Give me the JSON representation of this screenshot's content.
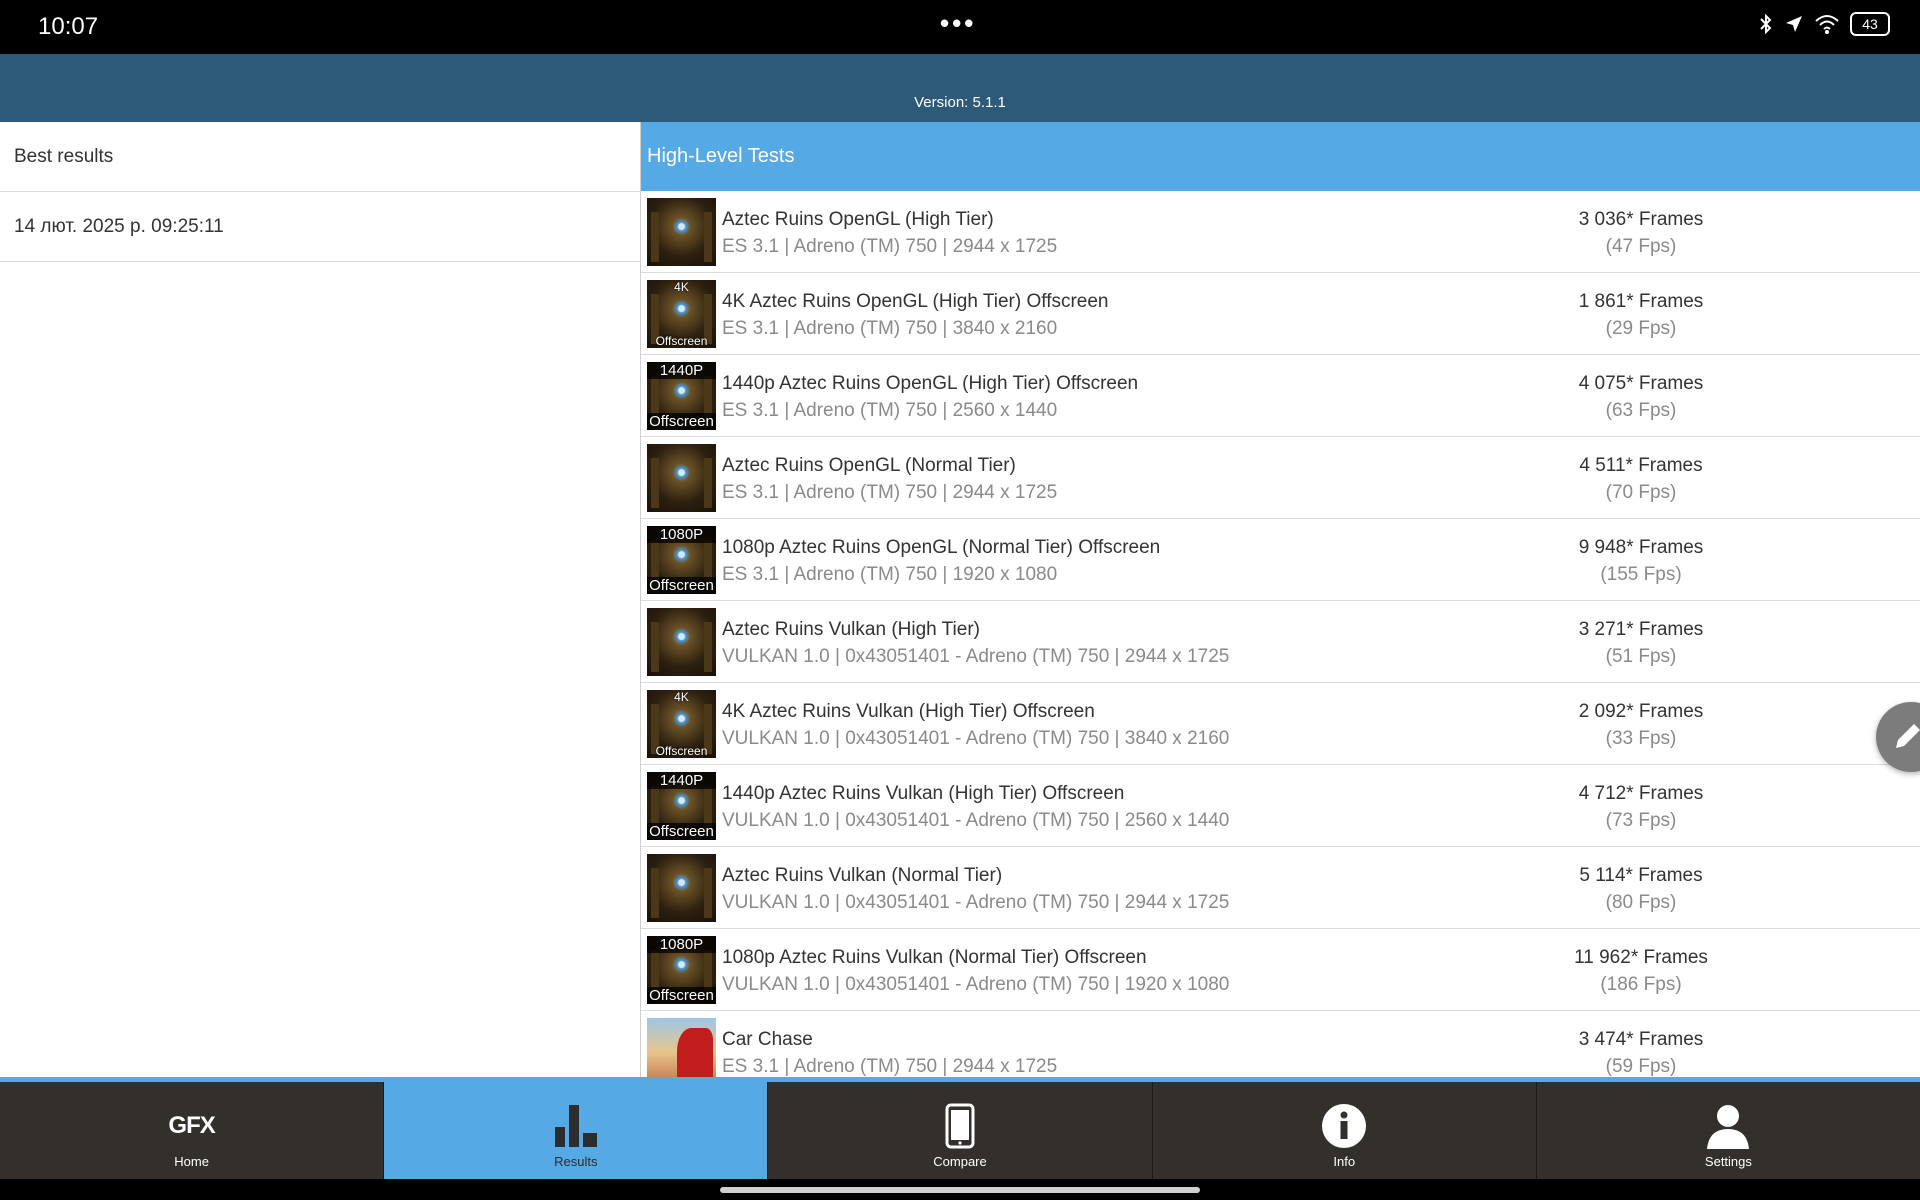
{
  "status_bar": {
    "time": "10:07",
    "dots": "•••",
    "battery": "43",
    "icons": [
      "bluetooth-icon",
      "location-icon",
      "wifi-icon",
      "battery-icon"
    ]
  },
  "header": {
    "version": "Version: 5.1.1"
  },
  "left_panel": {
    "best_results": "Best results",
    "date": "14 лют. 2025 р. 09:25:11"
  },
  "section": {
    "title": "High-Level Tests"
  },
  "results": [
    {
      "title": "Aztec Ruins OpenGL (High Tier)",
      "sub": "ES 3.1 | Adreno (TM) 750 | 2944 x 1725",
      "frames": "3 036* Frames",
      "fps": "(47 Fps)",
      "thumb_top": "",
      "thumb_bottom": ""
    },
    {
      "title": "4K Aztec Ruins OpenGL (High Tier) Offscreen",
      "sub": "ES 3.1 | Adreno (TM) 750 | 3840 x 2160",
      "frames": "1 861* Frames",
      "fps": "(29 Fps)",
      "thumb_top": "4K",
      "thumb_bottom": "Offscreen"
    },
    {
      "title": "1440p Aztec Ruins OpenGL (High Tier) Offscreen",
      "sub": "ES 3.1 | Adreno (TM) 750 | 2560 x 1440",
      "frames": "4 075* Frames",
      "fps": "(63 Fps)",
      "thumb_top": "1440P",
      "thumb_bottom": "Offscreen"
    },
    {
      "title": "Aztec Ruins OpenGL (Normal Tier)",
      "sub": "ES 3.1 | Adreno (TM) 750 | 2944 x 1725",
      "frames": "4 511* Frames",
      "fps": "(70 Fps)",
      "thumb_top": "",
      "thumb_bottom": ""
    },
    {
      "title": "1080p Aztec Ruins OpenGL (Normal Tier) Offscreen",
      "sub": "ES 3.1 | Adreno (TM) 750 | 1920 x 1080",
      "frames": "9 948* Frames",
      "fps": "(155 Fps)",
      "thumb_top": "1080P",
      "thumb_bottom": "Offscreen"
    },
    {
      "title": "Aztec Ruins Vulkan (High Tier)",
      "sub": "VULKAN 1.0 | 0x43051401 - Adreno (TM) 750 | 2944 x 1725",
      "frames": "3 271* Frames",
      "fps": "(51 Fps)",
      "thumb_top": "",
      "thumb_bottom": ""
    },
    {
      "title": "4K Aztec Ruins Vulkan (High Tier) Offscreen",
      "sub": "VULKAN 1.0 | 0x43051401 - Adreno (TM) 750 | 3840 x 2160",
      "frames": "2 092* Frames",
      "fps": "(33 Fps)",
      "thumb_top": "4K",
      "thumb_bottom": "Offscreen"
    },
    {
      "title": "1440p Aztec Ruins Vulkan (High Tier) Offscreen",
      "sub": "VULKAN 1.0 | 0x43051401 - Adreno (TM) 750 | 2560 x 1440",
      "frames": "4 712* Frames",
      "fps": "(73 Fps)",
      "thumb_top": "1440P",
      "thumb_bottom": "Offscreen"
    },
    {
      "title": "Aztec Ruins Vulkan (Normal Tier)",
      "sub": "VULKAN 1.0 | 0x43051401 - Adreno (TM) 750 | 2944 x 1725",
      "frames": "5 114* Frames",
      "fps": "(80 Fps)",
      "thumb_top": "",
      "thumb_bottom": ""
    },
    {
      "title": "1080p Aztec Ruins Vulkan (Normal Tier) Offscreen",
      "sub": "VULKAN 1.0 | 0x43051401 - Adreno (TM) 750 | 1920 x 1080",
      "frames": "11 962* Frames",
      "fps": "(186 Fps)",
      "thumb_top": "1080P",
      "thumb_bottom": "Offscreen"
    },
    {
      "title": "Car Chase",
      "sub": "ES 3.1 | Adreno (TM) 750 | 2944 x 1725",
      "frames": "3 474* Frames",
      "fps": "(59 Fps)",
      "thumb_top": "",
      "thumb_bottom": ""
    }
  ],
  "fab": {
    "icon": "pencil-icon"
  },
  "nav": {
    "home": {
      "label": "Home",
      "icon_text": "GFX"
    },
    "results": {
      "label": "Results"
    },
    "compare": {
      "label": "Compare"
    },
    "info": {
      "label": "Info"
    },
    "settings": {
      "label": "Settings"
    }
  },
  "colors": {
    "header": "#2c5a78",
    "accent": "#55a9e4",
    "nav_bg": "#332f2b"
  }
}
